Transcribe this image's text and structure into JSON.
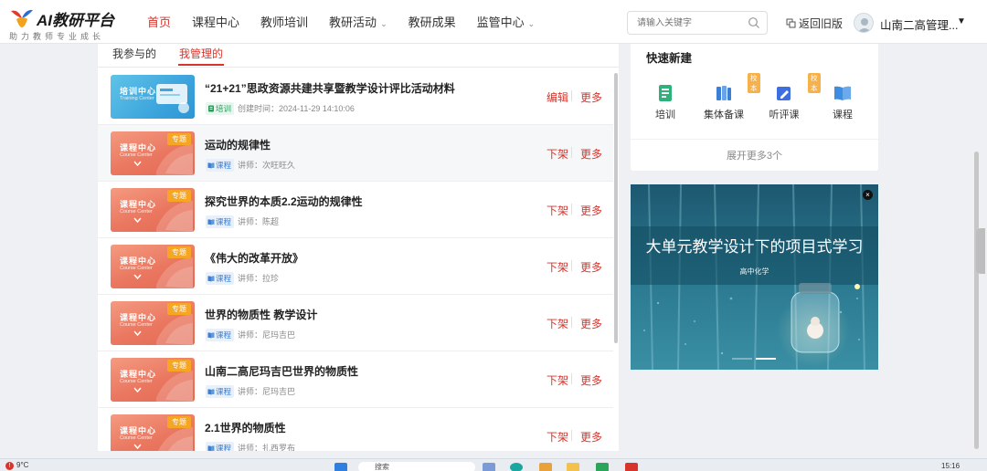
{
  "header": {
    "logo_title": "AI教研平台",
    "logo_sub": "助力教师专业成长",
    "nav": [
      {
        "label": "首页",
        "active": true,
        "caret": false
      },
      {
        "label": "课程中心",
        "active": false,
        "caret": false
      },
      {
        "label": "教师培训",
        "active": false,
        "caret": false
      },
      {
        "label": "教研活动",
        "active": false,
        "caret": true
      },
      {
        "label": "教研成果",
        "active": false,
        "caret": false
      },
      {
        "label": "监管中心",
        "active": false,
        "caret": true
      }
    ],
    "search_placeholder": "请输入关键字",
    "back_old": "返回旧版",
    "user_name": "山南二高管理...",
    "caret_glyph": "⌄",
    "user_caret": "▼"
  },
  "main": {
    "tabs": [
      {
        "label": "我参与的",
        "active": false
      },
      {
        "label": "我管理的",
        "active": true
      }
    ],
    "thumb_text": {
      "train_title": "培训中心",
      "train_sub": "Training Center",
      "course_title": "课程中心",
      "course_sub": "Course Center",
      "course_tag": "专题"
    },
    "items": [
      {
        "thumb": "train",
        "title": "“21+21”思政资源共建共享暨教学设计评比活动材料",
        "badge": "培训",
        "badge_type": "train",
        "meta_label": "创建时间：",
        "meta_value": "2024-11-29 14:10:06",
        "action1": "编辑",
        "action2": "更多",
        "highlight": false
      },
      {
        "thumb": "course",
        "title": "运动的规律性",
        "badge": "课程",
        "badge_type": "course",
        "meta_label": "讲师：",
        "meta_value": "次旺旺久",
        "action1": "下架",
        "action2": "更多",
        "highlight": true
      },
      {
        "thumb": "course",
        "title": "探究世界的本质2.2运动的规律性",
        "badge": "课程",
        "badge_type": "course",
        "meta_label": "讲师：",
        "meta_value": "陈超",
        "action1": "下架",
        "action2": "更多",
        "highlight": false
      },
      {
        "thumb": "course",
        "title": "《伟大的改革开放》",
        "badge": "课程",
        "badge_type": "course",
        "meta_label": "讲师：",
        "meta_value": "拉珍",
        "action1": "下架",
        "action2": "更多",
        "highlight": false
      },
      {
        "thumb": "course",
        "title": "世界的物质性 教学设计",
        "badge": "课程",
        "badge_type": "course",
        "meta_label": "讲师：",
        "meta_value": "尼玛吉巴",
        "action1": "下架",
        "action2": "更多",
        "highlight": false
      },
      {
        "thumb": "course",
        "title": "山南二高尼玛吉巴世界的物质性",
        "badge": "课程",
        "badge_type": "course",
        "meta_label": "讲师：",
        "meta_value": "尼玛吉巴",
        "action1": "下架",
        "action2": "更多",
        "highlight": false
      },
      {
        "thumb": "course",
        "title": "2.1世界的物质性",
        "badge": "课程",
        "badge_type": "course",
        "meta_label": "讲师：",
        "meta_value": "扎西罗布",
        "action1": "下架",
        "action2": "更多",
        "highlight": false
      }
    ]
  },
  "quick_create": {
    "title": "快速新建",
    "items": [
      {
        "label": "培训",
        "icon": "training-icon",
        "tag": "",
        "color": "#2fb27a"
      },
      {
        "label": "集体备课",
        "icon": "books-icon",
        "tag": "校本",
        "color": "#3d7fd4"
      },
      {
        "label": "听评课",
        "icon": "edit-icon",
        "tag": "校本",
        "color": "#3d6fe0"
      },
      {
        "label": "课程",
        "icon": "book-icon",
        "tag": "",
        "color": "#3d8ee0"
      }
    ],
    "expand_label": "展开更多3个"
  },
  "banner": {
    "title": "大单元教学设计下的项目式学习",
    "subtitle": "高中化学",
    "close_glyph": "×"
  },
  "taskbar": {
    "weather": "9°C",
    "warn_glyph": "!",
    "search": "搜索",
    "time": "15:16"
  },
  "colors": {
    "accent": "#d9342b",
    "tag_orange": "#f6a623"
  }
}
